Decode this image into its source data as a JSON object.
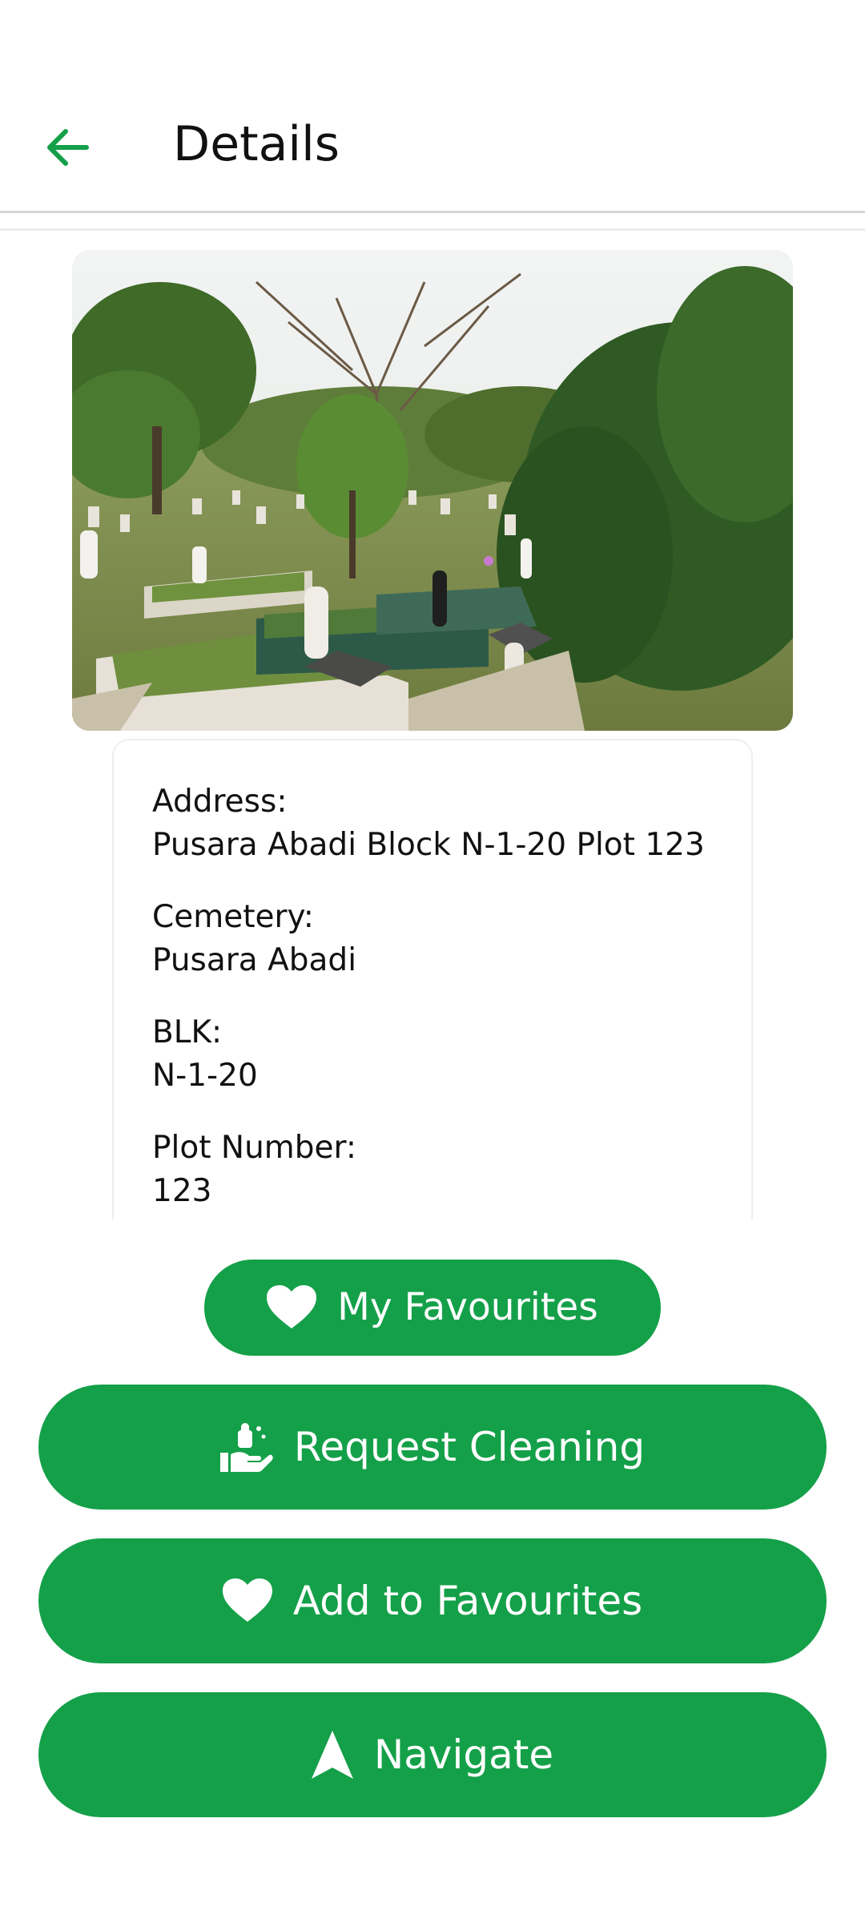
{
  "app_bar": {
    "title": "Details",
    "back_icon": "arrow-left-icon"
  },
  "photo": {
    "description_icon": "cemetery-photo"
  },
  "details": [
    {
      "label": "Address:",
      "value": "Pusara Abadi Block N-1-20 Plot 123"
    },
    {
      "label": "Cemetery:",
      "value": "Pusara Abadi"
    },
    {
      "label": "BLK:",
      "value": "N-1-20"
    },
    {
      "label": "Plot Number:",
      "value": "123"
    }
  ],
  "buttons": {
    "my_favourites": {
      "label": "My Favourites",
      "icon": "heart-icon"
    },
    "request_cleaning": {
      "label": "Request Cleaning",
      "icon": "cleaning-hand-icon"
    },
    "add_to_favourites": {
      "label": "Add to Favourites",
      "icon": "heart-icon"
    },
    "navigate": {
      "label": "Navigate",
      "icon": "navigation-arrow-icon"
    }
  },
  "colors": {
    "accent": "#14a049",
    "back_arrow": "#14a049",
    "button_text": "#ffffff"
  }
}
